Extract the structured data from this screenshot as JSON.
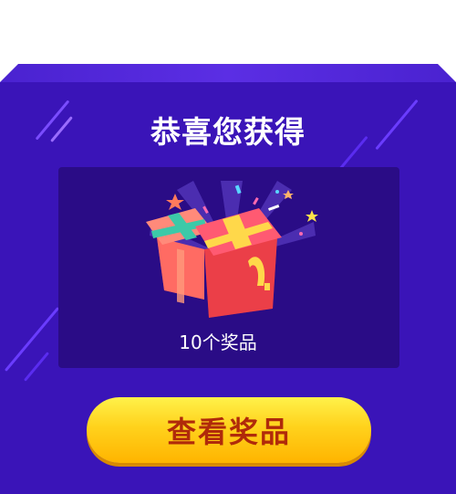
{
  "modal": {
    "title": "恭喜您获得",
    "prize_text": "10个奖品",
    "button_label": "查看奖品"
  },
  "colors": {
    "modal_bg": "#3a14b8",
    "card_bg": "#2a0c86",
    "button": "#ffd21c",
    "button_text": "#b02a0a"
  },
  "icons": [
    "gift-box-icon",
    "star-icon",
    "confetti-icon"
  ]
}
